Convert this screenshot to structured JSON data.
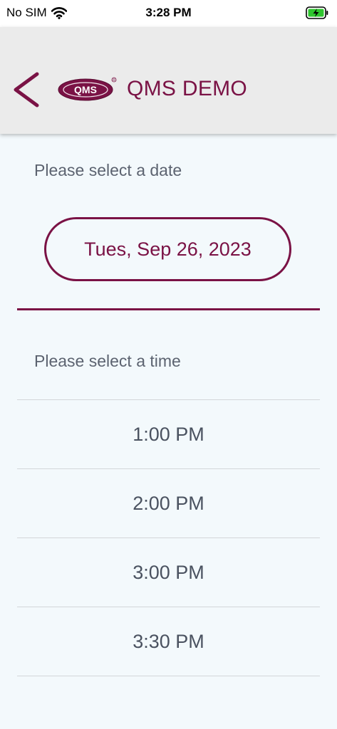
{
  "status_bar": {
    "carrier": "No SIM",
    "time": "3:28 PM"
  },
  "header": {
    "logo_text": "QMS",
    "title": "QMS DEMO"
  },
  "date_section": {
    "label": "Please select a date",
    "selected_date": "Tues, Sep 26, 2023"
  },
  "time_section": {
    "label": "Please select a time",
    "times": [
      "1:00 PM",
      "2:00 PM",
      "3:00 PM",
      "3:30 PM"
    ]
  },
  "colors": {
    "brand": "#7a1245",
    "background": "#f3f9fc",
    "header": "#ebebeb",
    "text_muted": "#5c6370",
    "battery_green": "#2ec52e"
  },
  "icons": {
    "signal": "wifi-icon",
    "battery": "battery-charging-icon",
    "back": "chevron-left-icon"
  }
}
